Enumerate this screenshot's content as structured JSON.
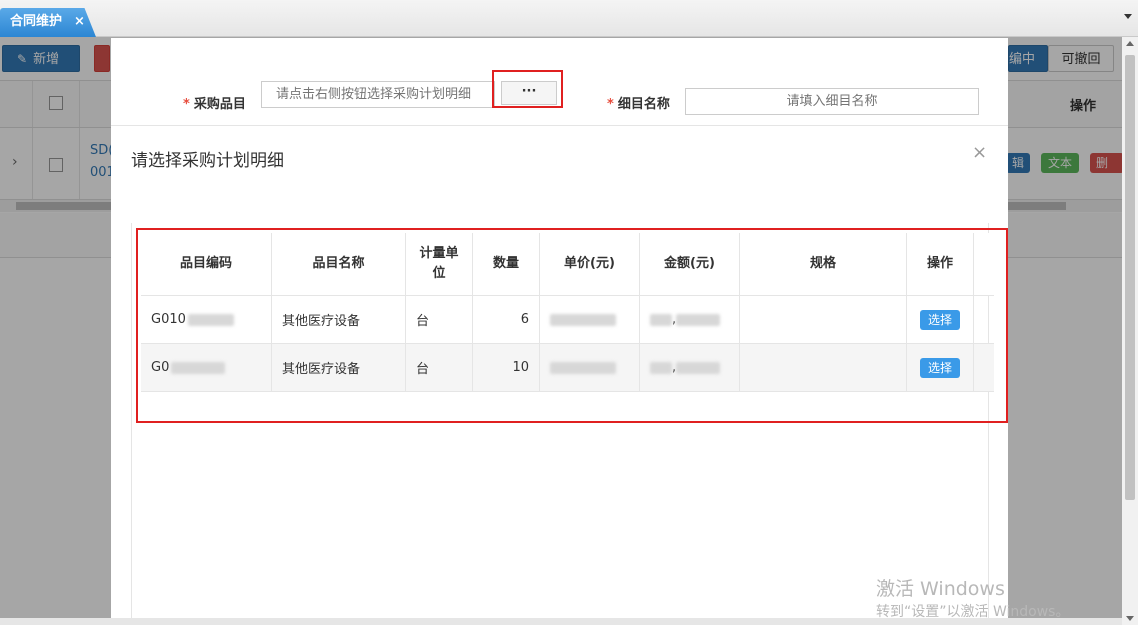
{
  "tabbar": {
    "active_tab": "合同维护",
    "close_glyph": "×"
  },
  "background": {
    "toolbar": {
      "new_label": "新增",
      "edit_label": "编中",
      "revoke_label": "可撤回"
    },
    "grid": {
      "op_header": "操作",
      "row": {
        "code_line1": "SD(",
        "code_line2": "001",
        "edit_action": "辑",
        "text_action": "文本",
        "delete_action": "删除"
      }
    }
  },
  "form": {
    "required_mark": "*",
    "category_label": "采购品目",
    "category_placeholder": "请点击右侧按钮选择采购计划明细",
    "dots_label": "···",
    "name_label": "细目名称",
    "name_placeholder": "请填入细目名称"
  },
  "dialog": {
    "title": "请选择采购计划明细",
    "close_glyph": "×",
    "columns": [
      "品目编码",
      "品目名称",
      "计量单位",
      "数量",
      "单价(元)",
      "金额(元)",
      "规格",
      "操作"
    ],
    "rows": [
      {
        "code": "G010",
        "name": "其他医疗设备",
        "unit": "台",
        "qty": "6",
        "price": "",
        "amount": ",",
        "spec": "",
        "action": "选择"
      },
      {
        "code": "G0",
        "name": "其他医疗设备",
        "unit": "台",
        "qty": "10",
        "price": "",
        "amount": ",",
        "spec": "",
        "action": "选择"
      }
    ]
  },
  "watermark": {
    "line1": "激活 Windows",
    "line2": "转到“设置”以激活 Windows。"
  },
  "colors": {
    "tab": "#2c86d3",
    "primary": "#337ab7",
    "select_button": "#3a9ae8",
    "highlight": "#e02020",
    "danger": "#d9534f",
    "success": "#5cb85c"
  }
}
